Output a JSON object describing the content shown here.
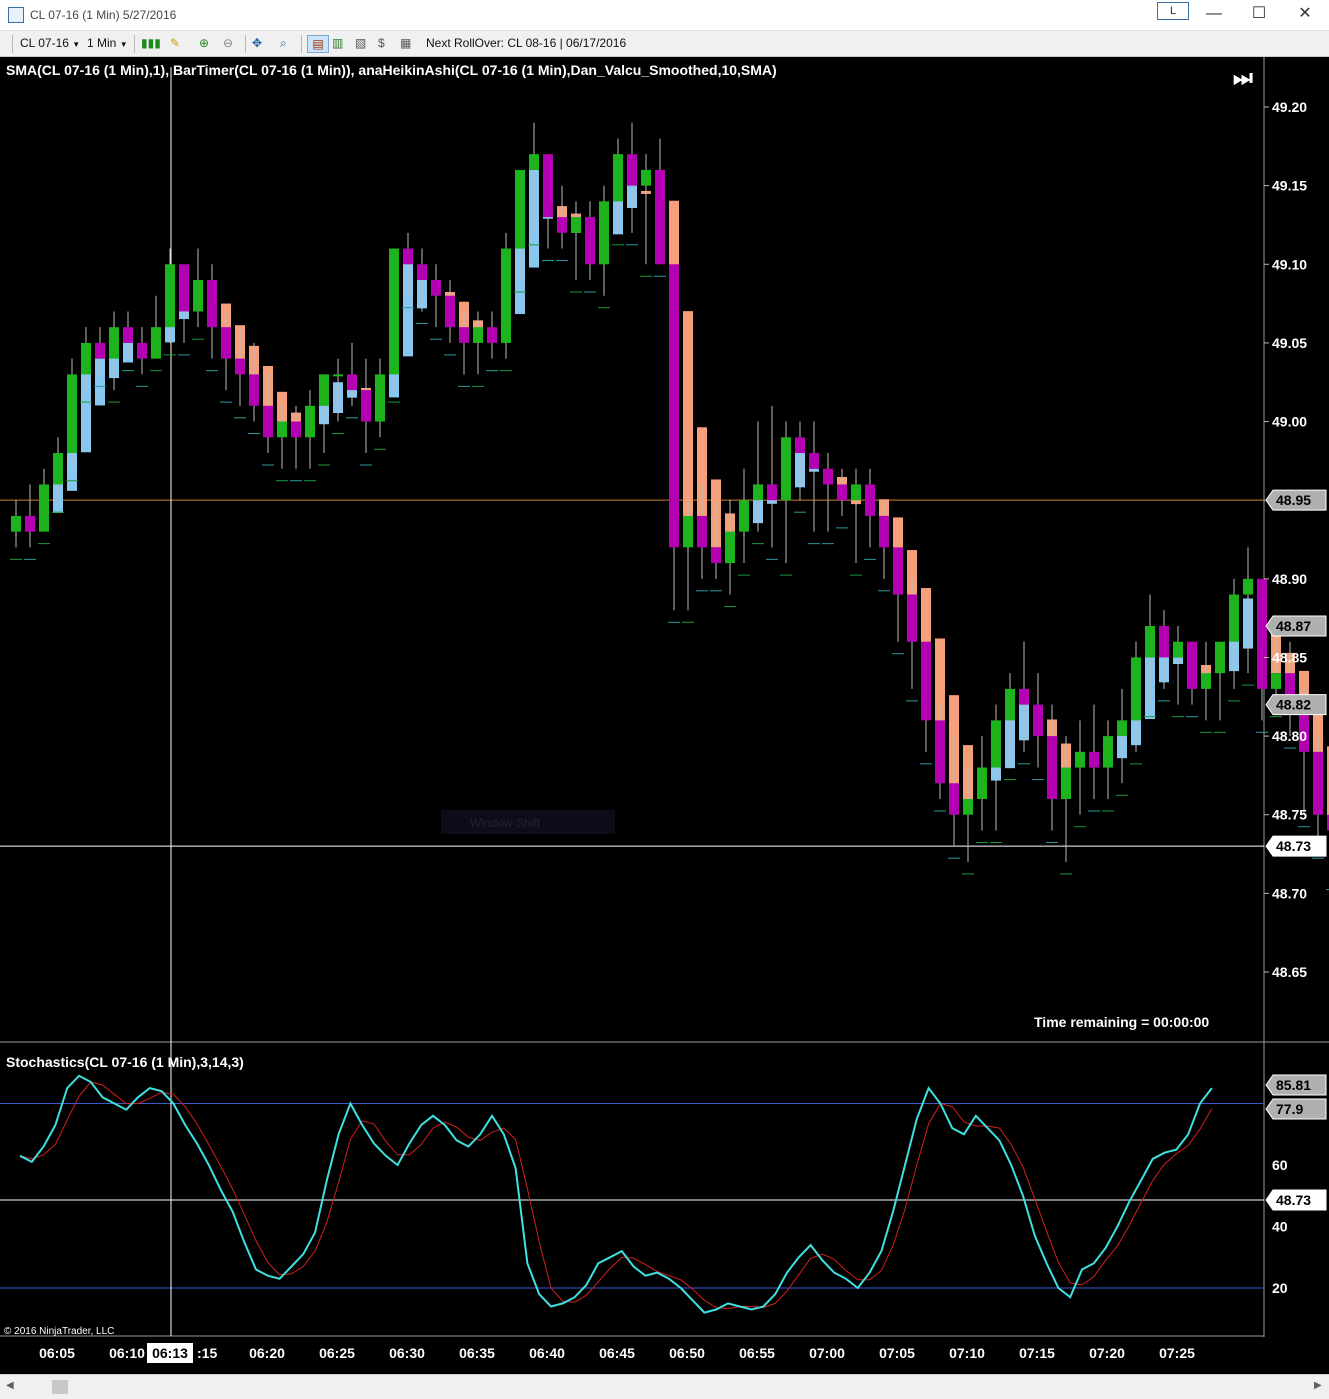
{
  "window": {
    "title": "CL 07-16 (1 Min)  5/27/2016",
    "badge": "L",
    "minimize": "—",
    "maximize": "☐",
    "close": "✕"
  },
  "toolbar": {
    "instrument": "CL 07-16",
    "interval": "1 Min",
    "rollover": "Next RollOver:  CL 08-16 | 06/17/2016"
  },
  "price_panel": {
    "indicator_label": "SMA(CL 07-16 (1 Min),1), BarTimer(CL 07-16 (1 Min)), anaHeikinAshi(CL 07-16 (1 Min),Dan_Valcu_Smoothed,10,SMA)",
    "time_remaining": "Time remaining = 00:00:00",
    "axis_ticks": [
      "49.20",
      "49.15",
      "49.10",
      "49.05",
      "49.00",
      "48.95",
      "48.90",
      "48.85",
      "48.80",
      "48.75",
      "48.70",
      "48.65"
    ],
    "price_flags": [
      {
        "label": "48.95",
        "value": 48.95,
        "style": "gray"
      },
      {
        "label": "48.87",
        "value": 48.87,
        "style": "gray"
      },
      {
        "label": "48.82",
        "value": 48.82,
        "style": "gray"
      },
      {
        "label": "48.73",
        "value": 48.73,
        "style": "white"
      }
    ],
    "hline_last_price": 48.95,
    "crosshair_price": 48.73,
    "watermark": "Window Shift"
  },
  "stoch_panel": {
    "label": "Stochastics(CL 07-16 (1 Min),3,14,3)",
    "axis_ticks": [
      "20",
      "40",
      "60"
    ],
    "flags": [
      {
        "label": "85.81",
        "value": 85.81,
        "style": "gray"
      },
      {
        "label": "77.9",
        "value": 77.9,
        "style": "gray"
      },
      {
        "label": "48.73",
        "value": 48,
        "style": "white"
      }
    ],
    "levels": [
      80,
      20
    ],
    "copyright": "© 2016 NinjaTrader, LLC"
  },
  "time_axis": {
    "labels": [
      "06:05",
      "06:10",
      "06:15",
      "06:20",
      "06:25",
      "06:30",
      "06:35",
      "06:40",
      "06:45",
      "06:50",
      "06:55",
      "07:00",
      "07:05",
      "07:10",
      "07:15",
      "07:20",
      "07:25"
    ],
    "crosshair_label": "06:13"
  },
  "colors": {
    "up": "#1db31d",
    "down": "#b300b3",
    "ha_up": "#88c8f0",
    "ha_down": "#f5a07a",
    "k_line": "#40e0e0",
    "d_line": "#d02020",
    "level_line": "#3c5ad0",
    "last_price": "#d08030"
  },
  "chart_data": {
    "type": "candlestick",
    "x_start": "06:03",
    "interval_minutes": 1,
    "ylim": [
      48.62,
      49.23
    ],
    "ohlc": [
      [
        48.93,
        48.95,
        48.92,
        48.94
      ],
      [
        48.94,
        48.96,
        48.92,
        48.93
      ],
      [
        48.93,
        48.97,
        48.93,
        48.96
      ],
      [
        48.96,
        48.99,
        48.95,
        48.98
      ],
      [
        48.98,
        49.04,
        48.97,
        49.03
      ],
      [
        49.03,
        49.06,
        49.02,
        49.05
      ],
      [
        49.05,
        49.06,
        49.03,
        49.04
      ],
      [
        49.04,
        49.07,
        49.02,
        49.06
      ],
      [
        49.06,
        49.07,
        49.04,
        49.05
      ],
      [
        49.05,
        49.06,
        49.03,
        49.04
      ],
      [
        49.04,
        49.08,
        49.04,
        49.06
      ],
      [
        49.06,
        49.11,
        49.05,
        49.1
      ],
      [
        49.1,
        49.1,
        49.05,
        49.07
      ],
      [
        49.07,
        49.11,
        49.06,
        49.09
      ],
      [
        49.09,
        49.1,
        49.04,
        49.06
      ],
      [
        49.06,
        49.07,
        49.02,
        49.04
      ],
      [
        49.04,
        49.06,
        49.01,
        49.03
      ],
      [
        49.03,
        49.05,
        49.0,
        49.01
      ],
      [
        49.01,
        49.03,
        48.98,
        48.99
      ],
      [
        48.99,
        49.01,
        48.97,
        49.0
      ],
      [
        49.0,
        49.01,
        48.97,
        48.99
      ],
      [
        48.99,
        49.02,
        48.97,
        49.01
      ],
      [
        49.01,
        49.03,
        48.98,
        49.03
      ],
      [
        49.03,
        49.04,
        49.0,
        49.03
      ],
      [
        49.03,
        49.05,
        49.01,
        49.02
      ],
      [
        49.02,
        49.04,
        48.98,
        49.0
      ],
      [
        49.0,
        49.04,
        48.99,
        49.03
      ],
      [
        49.03,
        49.11,
        49.02,
        49.11
      ],
      [
        49.11,
        49.12,
        49.08,
        49.1
      ],
      [
        49.1,
        49.11,
        49.07,
        49.09
      ],
      [
        49.09,
        49.1,
        49.06,
        49.08
      ],
      [
        49.08,
        49.09,
        49.05,
        49.06
      ],
      [
        49.06,
        49.07,
        49.03,
        49.05
      ],
      [
        49.05,
        49.07,
        49.03,
        49.06
      ],
      [
        49.06,
        49.07,
        49.04,
        49.05
      ],
      [
        49.05,
        49.12,
        49.04,
        49.11
      ],
      [
        49.11,
        49.15,
        49.09,
        49.16
      ],
      [
        49.16,
        49.19,
        49.12,
        49.17
      ],
      [
        49.17,
        49.17,
        49.11,
        49.13
      ],
      [
        49.13,
        49.15,
        49.11,
        49.12
      ],
      [
        49.12,
        49.14,
        49.09,
        49.13
      ],
      [
        49.13,
        49.14,
        49.09,
        49.1
      ],
      [
        49.1,
        49.15,
        49.08,
        49.14
      ],
      [
        49.14,
        49.18,
        49.12,
        49.17
      ],
      [
        49.17,
        49.19,
        49.12,
        49.15
      ],
      [
        49.15,
        49.17,
        49.1,
        49.16
      ],
      [
        49.16,
        49.18,
        49.1,
        49.1
      ],
      [
        49.1,
        49.1,
        48.88,
        48.92
      ],
      [
        48.92,
        48.95,
        48.88,
        48.94
      ],
      [
        48.94,
        48.96,
        48.9,
        48.92
      ],
      [
        48.92,
        48.95,
        48.9,
        48.91
      ],
      [
        48.91,
        48.95,
        48.89,
        48.93
      ],
      [
        48.93,
        48.97,
        48.91,
        48.95
      ],
      [
        48.95,
        49.0,
        48.93,
        48.96
      ],
      [
        48.96,
        49.01,
        48.92,
        48.95
      ],
      [
        48.95,
        49.0,
        48.91,
        48.99
      ],
      [
        48.99,
        49.0,
        48.95,
        48.98
      ],
      [
        48.98,
        49.0,
        48.93,
        48.97
      ],
      [
        48.97,
        48.98,
        48.93,
        48.96
      ],
      [
        48.96,
        48.97,
        48.94,
        48.95
      ],
      [
        48.95,
        48.97,
        48.91,
        48.96
      ],
      [
        48.96,
        48.97,
        48.92,
        48.94
      ],
      [
        48.94,
        48.95,
        48.9,
        48.92
      ],
      [
        48.92,
        48.92,
        48.86,
        48.89
      ],
      [
        48.89,
        48.9,
        48.83,
        48.86
      ],
      [
        48.86,
        48.86,
        48.79,
        48.81
      ],
      [
        48.81,
        48.82,
        48.76,
        48.77
      ],
      [
        48.77,
        48.8,
        48.73,
        48.75
      ],
      [
        48.75,
        48.78,
        48.72,
        48.76
      ],
      [
        48.76,
        48.8,
        48.74,
        48.78
      ],
      [
        48.78,
        48.82,
        48.74,
        48.81
      ],
      [
        48.81,
        48.84,
        48.78,
        48.83
      ],
      [
        48.83,
        48.86,
        48.79,
        48.82
      ],
      [
        48.82,
        48.84,
        48.78,
        48.8
      ],
      [
        48.8,
        48.82,
        48.74,
        48.76
      ],
      [
        48.76,
        48.8,
        48.72,
        48.78
      ],
      [
        48.78,
        48.81,
        48.75,
        48.79
      ],
      [
        48.79,
        48.82,
        48.76,
        48.78
      ],
      [
        48.78,
        48.81,
        48.76,
        48.8
      ],
      [
        48.8,
        48.83,
        48.77,
        48.81
      ],
      [
        48.81,
        48.86,
        48.79,
        48.85
      ],
      [
        48.85,
        48.89,
        48.82,
        48.87
      ],
      [
        48.87,
        48.88,
        48.83,
        48.85
      ],
      [
        48.85,
        48.87,
        48.82,
        48.86
      ],
      [
        48.86,
        48.86,
        48.82,
        48.83
      ],
      [
        48.83,
        48.86,
        48.81,
        48.84
      ],
      [
        48.84,
        48.86,
        48.81,
        48.86
      ],
      [
        48.86,
        48.9,
        48.83,
        48.89
      ],
      [
        48.89,
        48.92,
        48.84,
        48.9
      ],
      [
        48.9,
        48.9,
        48.81,
        48.83
      ],
      [
        48.83,
        48.87,
        48.82,
        48.84
      ],
      [
        48.84,
        48.86,
        48.8,
        48.82
      ],
      [
        48.82,
        48.83,
        48.75,
        48.79
      ],
      [
        48.79,
        48.8,
        48.73,
        48.75
      ],
      [
        48.75,
        48.78,
        48.71,
        48.74
      ],
      [
        48.74,
        48.78,
        48.72,
        48.77
      ],
      [
        48.77,
        48.79,
        48.74,
        48.76
      ],
      [
        48.76,
        48.79,
        48.74,
        48.77
      ],
      [
        48.77,
        48.82,
        48.75,
        48.81
      ],
      [
        48.81,
        48.84,
        48.77,
        48.84
      ],
      [
        48.84,
        48.85,
        48.8,
        48.82
      ],
      [
        48.82,
        48.85,
        48.8,
        48.84
      ],
      [
        48.84,
        48.86,
        48.81,
        48.85
      ],
      [
        48.85,
        48.88,
        48.83,
        48.87
      ],
      [
        48.87,
        48.91,
        48.85,
        48.91
      ],
      [
        48.91,
        49.01,
        48.9,
        48.95
      ]
    ],
    "stoch_k": [
      63,
      61,
      66,
      73,
      85,
      89,
      87,
      82,
      80,
      78,
      82,
      85,
      84,
      80,
      73,
      67,
      60,
      52,
      45,
      35,
      26,
      24,
      23,
      27,
      31,
      38,
      55,
      70,
      80,
      73,
      67,
      63,
      60,
      67,
      73,
      76,
      73,
      68,
      66,
      70,
      76,
      70,
      59,
      28,
      18,
      14,
      15,
      17,
      21,
      28,
      30,
      32,
      27,
      24,
      25,
      23,
      20,
      16,
      12,
      13,
      15,
      14,
      13,
      14,
      18,
      25,
      30,
      34,
      29,
      25,
      23,
      20,
      25,
      32,
      45,
      60,
      75,
      85,
      80,
      72,
      70,
      76,
      72,
      68,
      60,
      50,
      37,
      28,
      20,
      17,
      26,
      28,
      33,
      40,
      48,
      55,
      62,
      64,
      65,
      70,
      80,
      85
    ]
  }
}
